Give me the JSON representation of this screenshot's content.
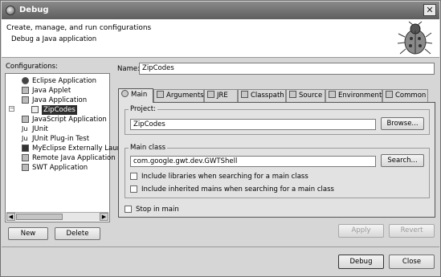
{
  "window": {
    "title": "Debug"
  },
  "header": {
    "title": "Create, manage, and run configurations",
    "subtitle": "Debug a Java application"
  },
  "configurations": {
    "label": "Configurations:",
    "items": [
      {
        "label": "Eclipse Application",
        "icon": "eclipse-icon"
      },
      {
        "label": "Java Applet",
        "icon": "applet-icon"
      },
      {
        "label": "Java Application",
        "icon": "java-app-icon",
        "expanded": true
      },
      {
        "label": "ZipCodes",
        "icon": "java-class-icon",
        "selected": true
      },
      {
        "label": "JavaScript Application",
        "icon": "javascript-icon"
      },
      {
        "label": "JUnit",
        "icon": "junit-icon"
      },
      {
        "label": "JUnit Plug-in Test",
        "icon": "junit-plugin-icon"
      },
      {
        "label": "MyEclipse Externally Laund",
        "icon": "myeclipse-icon"
      },
      {
        "label": "Remote Java Application",
        "icon": "remote-icon"
      },
      {
        "label": "SWT Application",
        "icon": "swt-icon"
      }
    ],
    "new_label": "New",
    "delete_label": "Delete"
  },
  "name": {
    "label": "Name:",
    "value": "ZipCodes"
  },
  "tabs": [
    {
      "label": "Main",
      "icon": "main-tab-icon",
      "active": true
    },
    {
      "label": "Arguments",
      "icon": "arguments-icon"
    },
    {
      "label": "JRE",
      "icon": "jre-icon"
    },
    {
      "label": "Classpath",
      "icon": "classpath-icon"
    },
    {
      "label": "Source",
      "icon": "source-icon"
    },
    {
      "label": "Environment",
      "icon": "environment-icon"
    },
    {
      "label": "Common",
      "icon": "common-icon"
    }
  ],
  "main_tab": {
    "project_label": "Project:",
    "project_value": "ZipCodes",
    "browse_label": "Browse...",
    "main_class_label": "Main class",
    "main_class_value": "com.google.gwt.dev.GWTShell",
    "search_label": "Search...",
    "include_libraries_label": "Include libraries when searching for a main class",
    "include_inherited_label": "Include inherited mains when searching for a main class",
    "stop_in_main_label": "Stop in main"
  },
  "actions": {
    "apply_label": "Apply",
    "revert_label": "Revert",
    "debug_label": "Debug",
    "close_label": "Close"
  }
}
